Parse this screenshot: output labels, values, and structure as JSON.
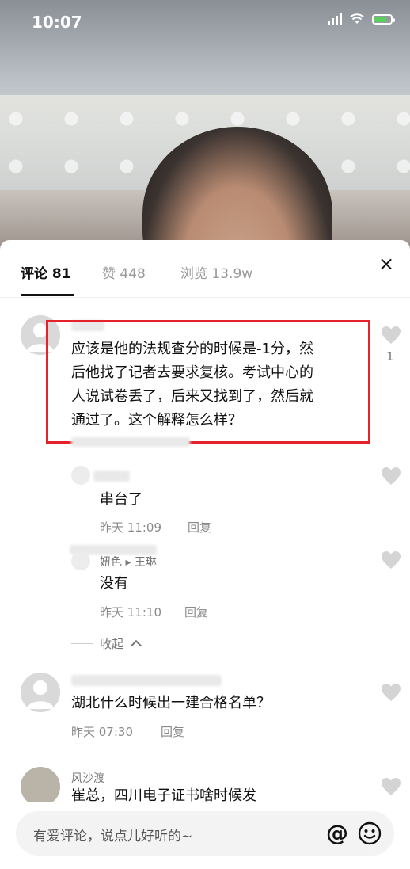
{
  "status": {
    "time": "10:07"
  },
  "tabs": [
    {
      "label": "评论 81"
    },
    {
      "label": "赞 448"
    },
    {
      "label": "浏览 13.9w"
    }
  ],
  "close": {
    "icon": "×"
  },
  "comments": [
    {
      "text": [
        "应该是他的法规查分的时候是-1分，然",
        "后他找了记者去要求复核。考试中心的",
        "人说试卷丢了，后来又找到了，然后就",
        "通过了。这个解释怎么样？"
      ],
      "likes": "1",
      "replies": [
        {
          "text": "串台了",
          "time": "昨天 11:09",
          "reply_label": "回复"
        },
        {
          "user": "妞色 ▸ 王琳",
          "text": "没有",
          "time": "昨天 11:10",
          "reply_label": "回复"
        }
      ],
      "collapse_label": "收起"
    },
    {
      "text": "湖北什么时候出一建合格名单？",
      "time": "昨天 07:30",
      "reply_label": "回复"
    },
    {
      "user": "风沙渡",
      "text": "崔总，四川电子证书啥时候发"
    }
  ],
  "input": {
    "placeholder": "有爱评论，说点儿好听的~",
    "at": "@"
  },
  "colors": {
    "highlight": "#e5222a"
  }
}
